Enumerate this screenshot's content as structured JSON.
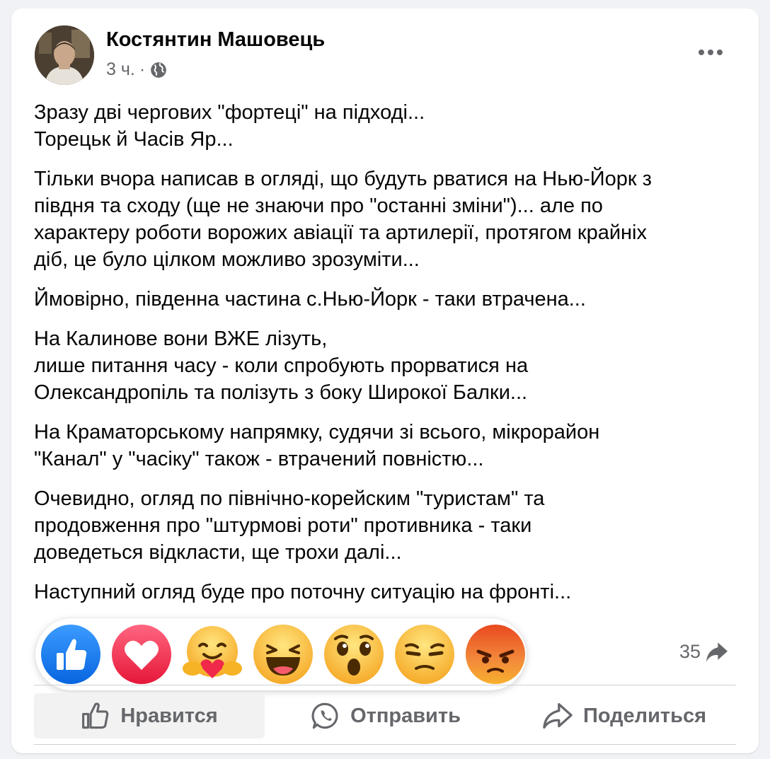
{
  "post": {
    "author": "Костянтин Машовець",
    "time": "3 ч.",
    "separator": "·",
    "paragraphs": [
      [
        "Зразу дві чергових \"фортеці\" на підході...",
        "Торецьк й Часів Яр..."
      ],
      [
        "Тільки вчора написав в огляді, що будуть рватися на Нью-Йорк з",
        "півдня та сходу (ще не знаючи про \"останні зміни\")... але по",
        "характеру роботи ворожих авіації та артилерії, протягом крайніх",
        "діб, це було цілком можливо зрозуміти..."
      ],
      [
        "Ймовірно, південна частина с.Нью-Йорк - таки втрачена..."
      ],
      [
        "На Калинове вони ВЖЕ лізуть,",
        "лише питання часу - коли спробують прорватися на",
        "Олександропіль та полізуть з боку Широкої Балки..."
      ],
      [
        "На Краматорському напрямку, судячи зі всього, мікрорайон",
        "\"Канал\" у \"часіку\" також - втрачений повністю..."
      ],
      [
        "Очевидно, огляд по північно-корейским \"туристам\" та",
        "продовження про \"штурмові роти\" противника - таки",
        "доведеться відкласти, ще трохи далі..."
      ],
      [
        "Наступний огляд буде про поточну ситуацію на фронті..."
      ]
    ]
  },
  "reactions": [
    {
      "name": "like",
      "icon": "like-reaction-icon",
      "color": "#1877f2"
    },
    {
      "name": "love",
      "icon": "love-reaction-icon",
      "color": "#f33e58"
    },
    {
      "name": "care",
      "icon": "care-reaction-icon",
      "color": "#f7b125"
    },
    {
      "name": "haha",
      "icon": "haha-reaction-icon",
      "color": "#f7b125"
    },
    {
      "name": "wow",
      "icon": "wow-reaction-icon",
      "color": "#f7b125"
    },
    {
      "name": "sad",
      "icon": "sad-reaction-icon",
      "color": "#f7b125"
    },
    {
      "name": "angry",
      "icon": "angry-reaction-icon",
      "color": "#e9710f"
    }
  ],
  "shares": {
    "count": "35",
    "icon": "share-arrow-icon"
  },
  "actions": {
    "like_label": "Нравится",
    "send_label": "Отправить",
    "share_label": "Поделиться"
  },
  "colors": {
    "text": "#050505",
    "secondary": "#65676b",
    "background": "#f0f2f5",
    "accent": "#1877f2"
  }
}
